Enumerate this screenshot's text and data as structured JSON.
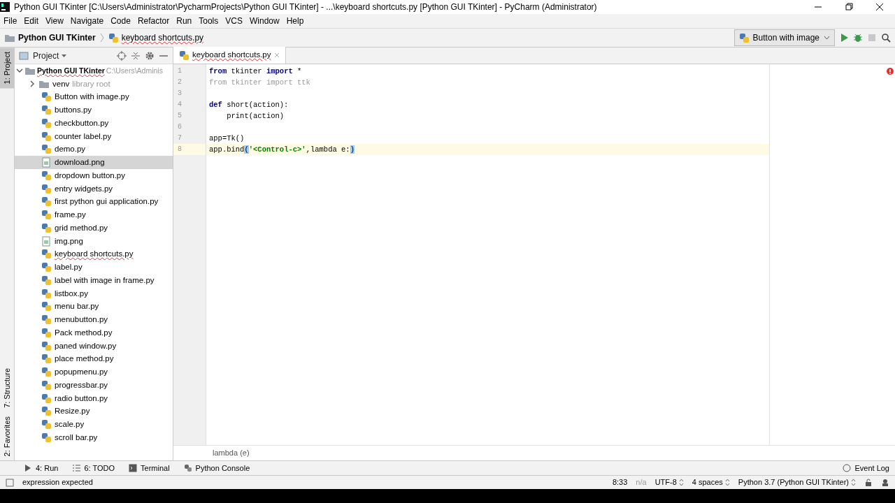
{
  "window": {
    "title": "Python GUI TKinter [C:\\Users\\Administrator\\PycharmProjects\\Python GUI TKinter] - ...\\keyboard shortcuts.py [Python GUI TKinter] - PyCharm (Administrator)"
  },
  "menu": [
    "File",
    "Edit",
    "View",
    "Navigate",
    "Code",
    "Refactor",
    "Run",
    "Tools",
    "VCS",
    "Window",
    "Help"
  ],
  "breadcrumbs": [
    {
      "label": "Python GUI TKinter",
      "kind": "folder"
    },
    {
      "label": "keyboard shortcuts.py",
      "kind": "py"
    }
  ],
  "run_config": {
    "label": "Button with image"
  },
  "side_strip": [
    {
      "label": "1: Project",
      "selected": true
    },
    {
      "label": "7: Structure",
      "selected": false
    },
    {
      "label": "2: Favorites",
      "selected": false
    }
  ],
  "project_panel": {
    "title": "Project",
    "root": {
      "label": "Python GUI TKinter",
      "hint": "C:\\Users\\Adminis",
      "expanded": true,
      "children": [
        {
          "label": "venv",
          "hint": "library root",
          "kind": "folder",
          "expanded": false,
          "selected": false
        },
        {
          "label": "Button with image.py",
          "kind": "py",
          "selected": false
        },
        {
          "label": "buttons.py",
          "kind": "py",
          "selected": false
        },
        {
          "label": "checkbutton.py",
          "kind": "py",
          "selected": false
        },
        {
          "label": "counter label.py",
          "kind": "py",
          "selected": false
        },
        {
          "label": "demo.py",
          "kind": "py",
          "selected": false
        },
        {
          "label": "download.png",
          "kind": "png",
          "selected": true
        },
        {
          "label": "dropdown button.py",
          "kind": "py",
          "selected": false
        },
        {
          "label": "entry widgets.py",
          "kind": "py",
          "selected": false
        },
        {
          "label": "first python gui application.py",
          "kind": "py",
          "selected": false
        },
        {
          "label": "frame.py",
          "kind": "py",
          "selected": false
        },
        {
          "label": "grid method.py",
          "kind": "py",
          "selected": false
        },
        {
          "label": "img.png",
          "kind": "png",
          "selected": false
        },
        {
          "label": "keyboard shortcuts.py",
          "kind": "py",
          "selected": false
        },
        {
          "label": "label.py",
          "kind": "py",
          "selected": false
        },
        {
          "label": "label with image in frame.py",
          "kind": "py",
          "selected": false
        },
        {
          "label": "listbox.py",
          "kind": "py",
          "selected": false
        },
        {
          "label": "menu bar.py",
          "kind": "py",
          "selected": false
        },
        {
          "label": "menubutton.py",
          "kind": "py",
          "selected": false
        },
        {
          "label": "Pack method.py",
          "kind": "py",
          "selected": false
        },
        {
          "label": "paned window.py",
          "kind": "py",
          "selected": false
        },
        {
          "label": "place method.py",
          "kind": "py",
          "selected": false
        },
        {
          "label": "popupmenu.py",
          "kind": "py",
          "selected": false
        },
        {
          "label": "progressbar.py",
          "kind": "py",
          "selected": false
        },
        {
          "label": "radio button.py",
          "kind": "py",
          "selected": false
        },
        {
          "label": "Resize.py",
          "kind": "py",
          "selected": false
        },
        {
          "label": "scale.py",
          "kind": "py",
          "selected": false
        },
        {
          "label": "scroll bar.py",
          "kind": "py",
          "selected": false
        }
      ]
    }
  },
  "editor": {
    "tab": {
      "label": "keyboard shortcuts.py",
      "selected": true
    },
    "lines": [
      {
        "number": "1",
        "current": false,
        "tokens": [
          {
            "text": "from",
            "kind": "keyword"
          },
          {
            "text": " tkinter ",
            "kind": "plain"
          },
          {
            "text": "import",
            "kind": "keyword"
          },
          {
            "text": " *",
            "kind": "plain"
          }
        ]
      },
      {
        "number": "2",
        "current": false,
        "tokens": [
          {
            "text": "from tkinter import ttk",
            "kind": "unused"
          }
        ]
      },
      {
        "number": "3",
        "current": false
      },
      {
        "number": "4",
        "current": false,
        "tokens": [
          {
            "text": "def",
            "kind": "keyword"
          },
          {
            "text": " short(action):",
            "kind": "plain"
          }
        ]
      },
      {
        "number": "5",
        "current": false,
        "tokens": [
          {
            "text": "    print(action)",
            "kind": "plain"
          }
        ]
      },
      {
        "number": "6",
        "current": false
      },
      {
        "number": "7",
        "current": false,
        "tokens": [
          {
            "text": "app=Tk()",
            "kind": "plain"
          }
        ]
      },
      {
        "number": "8",
        "current": true,
        "tokens": [
          {
            "text": "app.bind",
            "kind": "plain"
          },
          {
            "text": "(",
            "kind": "match"
          },
          {
            "text": "'<Control-c>'",
            "kind": "string"
          },
          {
            "text": ",lambda e:",
            "kind": "plain"
          },
          {
            "text": ")",
            "kind": "match"
          }
        ]
      }
    ],
    "breadcrumb": "lambda (e)"
  },
  "tool_tabs": [
    {
      "label": "4: Run",
      "kind": "run"
    },
    {
      "label": "6: TODO",
      "kind": "todo"
    },
    {
      "label": "Terminal",
      "kind": "terminal"
    },
    {
      "label": "Python Console",
      "kind": "console"
    }
  ],
  "event_log": "Event Log",
  "status_bar": {
    "message": "expression expected",
    "position": "8:33",
    "na": "n/a",
    "encoding": "UTF-8",
    "indent": "4 spaces",
    "interpreter": "Python 3.7 (Python GUI TKinter)"
  }
}
